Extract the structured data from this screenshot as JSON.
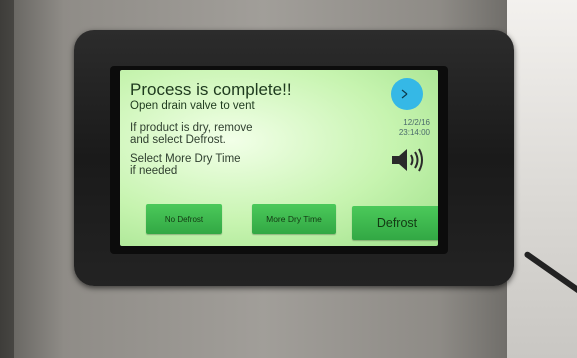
{
  "screen": {
    "title": "Process is complete!!",
    "subtitle": "Open drain valve to vent",
    "instructions": [
      "If product is dry, remove",
      "and select Defrost.",
      "Select More Dry Time",
      "if needed"
    ],
    "date": "12/2/16",
    "time": "23:14:00",
    "buttons": {
      "no_defrost": "No Defrost",
      "more_dry_time": "More Dry Time",
      "defrost": "Defrost"
    },
    "colors": {
      "screen_bg": "#c7f4b0",
      "button": "#3fb84f",
      "clock": "#35b8e6"
    },
    "icons": [
      "clock-icon",
      "speaker-icon"
    ]
  }
}
